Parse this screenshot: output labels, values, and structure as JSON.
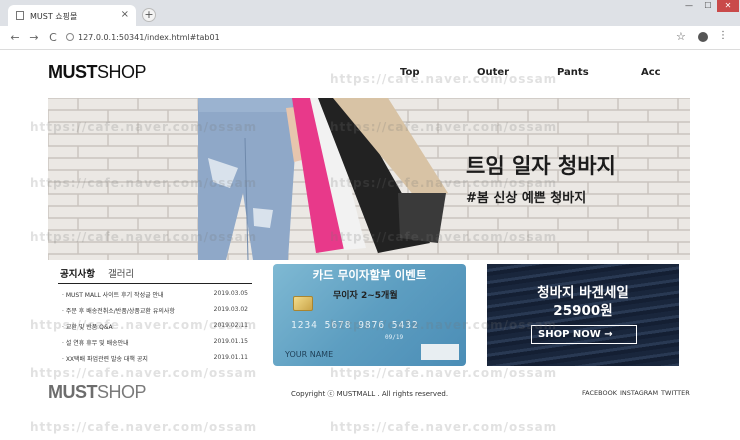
{
  "browser": {
    "tab_title": "MUST 쇼핑몰",
    "tab_close": "×",
    "new_tab": "+",
    "win_min": "—",
    "win_max": "☐",
    "win_close": "✕",
    "back": "←",
    "forward": "→",
    "reload": "C",
    "url": "127.0.0.1:50341/index.html#tab01",
    "star": "☆",
    "menu": "⋮"
  },
  "header": {
    "logo_bold": "MUST",
    "logo_light": "SHOP",
    "nav": [
      "Top",
      "Outer",
      "Pants",
      "Acc"
    ]
  },
  "banner": {
    "title": "트임 일자 청바지",
    "subtitle": "#봄 신상 예쁜 청바지"
  },
  "notice": {
    "tabs": [
      "공지사항",
      "갤러리"
    ],
    "items": [
      {
        "title": "· MUST MALL 사이트 후기 작성글 안내",
        "date": "2019.03.05"
      },
      {
        "title": "· 주문 후 배송전취소/반품/상품교환 유의사항",
        "date": "2019.03.02"
      },
      {
        "title": "· 교환 및 반품 Q&A",
        "date": "2019.02.11"
      },
      {
        "title": "· 설 연휴 휴무 및 배송안내",
        "date": "2019.01.15"
      },
      {
        "title": "· XX택배 파업관련 발송 대책 공지",
        "date": "2019.01.11"
      }
    ]
  },
  "card_event": {
    "title": "카드 무이자할부 이벤트",
    "subtitle": "무이자 2~5개월",
    "number": "1234 5678 9876 5432",
    "expiry": "09/19",
    "holder": "YOUR NAME"
  },
  "sale_event": {
    "title": "청바지 바겐세일",
    "price": "25900원",
    "button": "SHOP NOW →"
  },
  "footer": {
    "logo_bold": "MUST",
    "logo_light": "SHOP",
    "copyright": "Copyright ⓒ MUSTMALL . All rights reserved.",
    "social": [
      "FACEBOOK",
      "INSTAGRAM",
      "TWITTER"
    ]
  },
  "watermark": "https://cafe.naver.com/ossam",
  "colors": {
    "card_blue": "#5d9ec1",
    "denim_dark": "#23344e",
    "bag_pink": "#e8398a",
    "bag_beige": "#d8c3a5"
  }
}
